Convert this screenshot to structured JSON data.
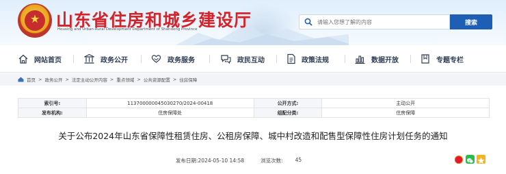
{
  "site": {
    "title": "山东省住房和城乡建设厅",
    "subtitle": "Housing and Urban-Rural Development Department of Shandong Province"
  },
  "search": {
    "placeholder": "请输入您想了解的内容",
    "button_label": "搜索"
  },
  "nav": {
    "items": [
      {
        "label": "网站首页",
        "icon": "home-icon"
      },
      {
        "label": "政务公开",
        "icon": "government-building-icon"
      },
      {
        "label": "政务服务",
        "icon": "heart-hand-icon"
      },
      {
        "label": "政民互动",
        "icon": "chat-icon"
      },
      {
        "label": "政策法规",
        "icon": "document-icon"
      },
      {
        "label": "数据开放",
        "icon": "bar-chart-icon"
      },
      {
        "label": "专题专栏",
        "icon": "topic-icon"
      }
    ]
  },
  "breadcrumb": {
    "items": [
      "首页",
      "政务公开",
      "法定主动公开内容",
      "重点领域",
      "公共资源配置",
      "住房保障"
    ],
    "separator": ">"
  },
  "meta": {
    "index_label": "索引号:",
    "index_value": "11370000004503027​0/2024-00418",
    "publicity_label": "公开方式:",
    "publicity_value": "主动公开",
    "issuer_label": "发布机构:",
    "issuer_value": "住房保障处",
    "category_label": "组配分类:",
    "category_value": "住房保障"
  },
  "document": {
    "title": "关于公布2024年山东省保障性租赁住房、公租房保障、城中村改造和配售型保障性住房计划任务的通知",
    "publish_label": "发布日期:",
    "publish_date": "2024-05-10 14:58",
    "views_label": "浏览次数:",
    "views_count": "45"
  },
  "share": {
    "icons": [
      "weibo-icon",
      "wechat-icon",
      "qzone-icon"
    ]
  },
  "colors": {
    "brand_red": "#d2242a",
    "search_blue": "#1e5fb5",
    "nav_text": "#2e3c53"
  }
}
